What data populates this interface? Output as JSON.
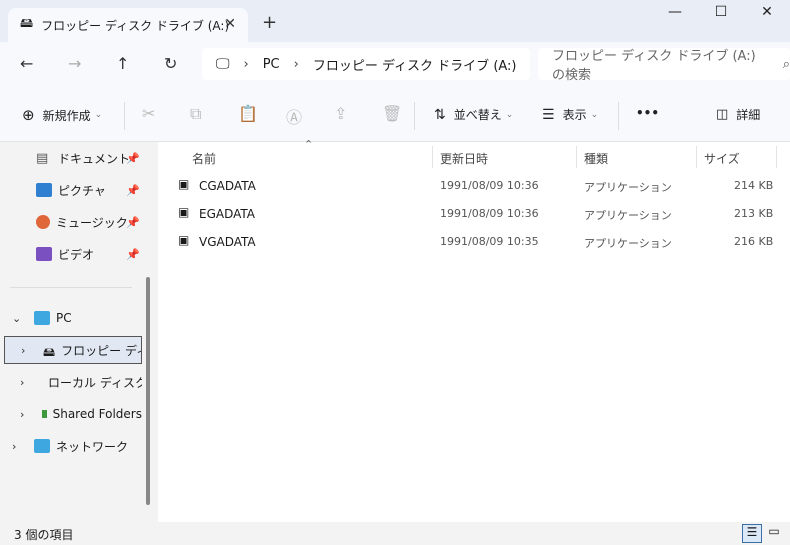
{
  "window": {
    "tab_title": "フロッピー ディスク ドライブ (A:)",
    "tab_close": "✕",
    "new_tab": "+",
    "minimize": "—",
    "maximize": "☐",
    "close": "✕"
  },
  "address": {
    "root": "PC",
    "current": "フロッピー ディスク ドライブ (A:)",
    "separator": "›",
    "search_placeholder": "フロッピー ディスク ドライブ (A:)の検索"
  },
  "toolbar": {
    "new_label": "新規作成",
    "sort_label": "並べ替え",
    "view_label": "表示",
    "more": "•••",
    "details_label": "詳細"
  },
  "sidebar": {
    "quick": [
      {
        "label": "ドキュメント",
        "icon": "document-icon"
      },
      {
        "label": "ピクチャ",
        "icon": "pictures-icon"
      },
      {
        "label": "ミュージック",
        "icon": "music-icon"
      },
      {
        "label": "ビデオ",
        "icon": "video-icon"
      }
    ],
    "pc_label": "PC",
    "floppy_label": "フロッピー ディスク",
    "local_label": "ローカル ディスク",
    "shared_label": "Shared Folders",
    "network_label": "ネットワーク"
  },
  "columns": {
    "name": "名前",
    "date": "更新日時",
    "type": "種類",
    "size": "サイズ"
  },
  "files": [
    {
      "name": "CGADATA",
      "date": "1991/08/09 10:36",
      "type": "アプリケーション",
      "size": "214 KB"
    },
    {
      "name": "EGADATA",
      "date": "1991/08/09 10:36",
      "type": "アプリケーション",
      "size": "213 KB"
    },
    {
      "name": "VGADATA",
      "date": "1991/08/09 10:35",
      "type": "アプリケーション",
      "size": "216 KB"
    }
  ],
  "status": {
    "count": "3 個の項目"
  },
  "colors": {
    "accent": "#3a6ea5",
    "selected_bg": "#e2e8f3"
  }
}
